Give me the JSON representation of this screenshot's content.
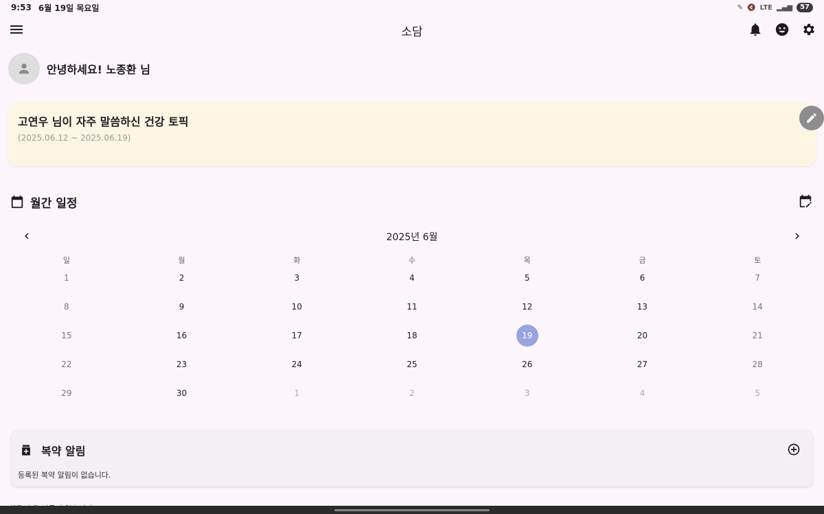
{
  "status": {
    "time": "9:53",
    "date": "6월 19일 목요일",
    "network": "LTE",
    "battery": "57"
  },
  "appbar": {
    "title": "소담"
  },
  "greeting": {
    "text": "안녕하세요! 노종환 님"
  },
  "topic": {
    "title": "고연우 님이 자주 말씀하신 건강 토픽",
    "range": "(2025.06.12 ~ 2025.06.19)"
  },
  "schedule": {
    "label": "월간 일정"
  },
  "calendar": {
    "month_label": "2025년 6월",
    "weekdays": [
      "일",
      "월",
      "화",
      "수",
      "목",
      "금",
      "토"
    ],
    "days": [
      "1",
      "2",
      "3",
      "4",
      "5",
      "6",
      "7",
      "8",
      "9",
      "10",
      "11",
      "12",
      "13",
      "14",
      "15",
      "16",
      "17",
      "18",
      "19",
      "20",
      "21",
      "22",
      "23",
      "24",
      "25",
      "26",
      "27",
      "28",
      "29",
      "30",
      "1",
      "2",
      "3",
      "4",
      "5"
    ],
    "today": "19"
  },
  "medication": {
    "label": "복약 알림",
    "empty_text": "등록된 복약 알림이 없습니다."
  },
  "recent": {
    "empty_text": "최근 호출 기록이 없습니다."
  },
  "colors": {
    "background": "#fcf6fc",
    "topic_card": "#fdf5e3",
    "today": "#9aa4dd",
    "med_card": "#f4eff4"
  }
}
